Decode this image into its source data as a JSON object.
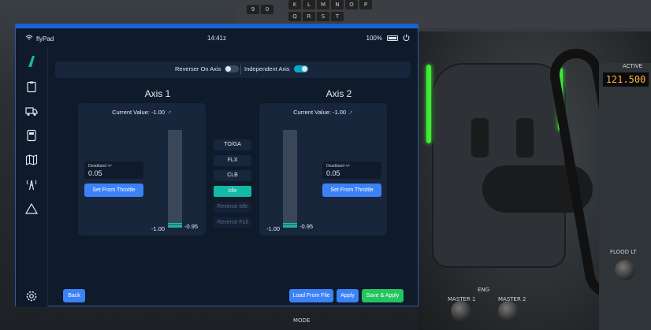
{
  "window": {
    "app_name": "flyPad",
    "time": "14:41z",
    "battery": "100%"
  },
  "toggles": {
    "reverser_label": "Reverser On Axis",
    "reverser_on": false,
    "independent_label": "Independent Axis",
    "independent_on": true
  },
  "axis1": {
    "title": "Axis 1",
    "current_value": "Current Value: -1.00",
    "deadband_label": "Deadband +/-",
    "deadband_value": "0.05",
    "set_button": "Set From Throttle",
    "min_label": "-1.00",
    "max_label": "-0.95"
  },
  "axis2": {
    "title": "Axis 2",
    "current_value": "Current Value: -1.00",
    "deadband_label": "Deadband +/-",
    "deadband_value": "0.05",
    "set_button": "Set From Throttle",
    "min_label": "-1.00",
    "max_label": "-0.95"
  },
  "detents": [
    {
      "label": "TO/GA",
      "state": "on"
    },
    {
      "label": "FLX",
      "state": "on"
    },
    {
      "label": "CLB",
      "state": "on"
    },
    {
      "label": "Idle",
      "state": "selected"
    },
    {
      "label": "Reverse Idle",
      "state": "off"
    },
    {
      "label": "Reverse Full",
      "state": "off"
    }
  ],
  "footer": {
    "back": "Back",
    "load": "Load From File",
    "apply": "Apply",
    "save_apply": "Save & Apply"
  },
  "sidebar": {
    "items": [
      "logo-icon",
      "clipboard-icon",
      "truck-icon",
      "calculator-icon",
      "map-icon",
      "tower-icon",
      "warning-icon",
      "settings-icon"
    ]
  },
  "background": {
    "keys_row1": [
      "9",
      "0",
      "K",
      "L",
      "M",
      "N",
      "O",
      "P"
    ],
    "keys_row2": [
      "Q",
      "R",
      "S",
      "T"
    ],
    "frequency": "121.500",
    "labels": {
      "active": "ACTIVE",
      "flood": "FLOOD LT",
      "eng": "ENG",
      "master1": "MASTER 1",
      "master2": "MASTER 2",
      "mode": "MODE"
    }
  },
  "colors": {
    "accent": "#3b82f6",
    "teal": "#14b8a6",
    "panel": "#18263c",
    "window_bg": "#0f1a2b",
    "green_arc": "#3fea37"
  }
}
